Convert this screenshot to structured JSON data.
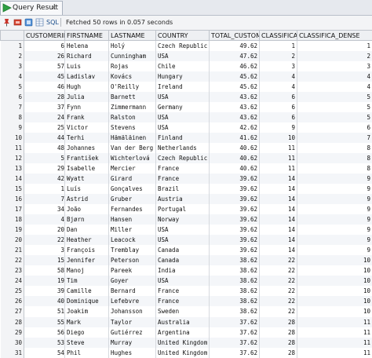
{
  "tab": {
    "title": "Query Result",
    "close_glyph": "x"
  },
  "toolbar": {
    "icons": [
      "pin-icon",
      "red-icon",
      "blue-icon",
      "grid-icon"
    ],
    "sql_label": "SQL",
    "status": "Fetched 50 rows in 0.057 seconds"
  },
  "grid": {
    "columns": [
      "CUSTOMERID",
      "FIRSTNAME",
      "LASTNAME",
      "COUNTRY",
      "TOTAL_CUSTOMER",
      "CLASSIFICA",
      "CLASSIFICA_DENSE"
    ],
    "rows": [
      [
        "1",
        "6",
        "Helena",
        "Holý",
        "Czech Republic",
        "49.62",
        "1",
        "1"
      ],
      [
        "2",
        "26",
        "Richard",
        "Cunningham",
        "USA",
        "47.62",
        "2",
        "2"
      ],
      [
        "3",
        "57",
        "Luis",
        "Rojas",
        "Chile",
        "46.62",
        "3",
        "3"
      ],
      [
        "4",
        "45",
        "Ladislav",
        "Kovács",
        "Hungary",
        "45.62",
        "4",
        "4"
      ],
      [
        "5",
        "46",
        "Hugh",
        "O'Reilly",
        "Ireland",
        "45.62",
        "4",
        "4"
      ],
      [
        "6",
        "28",
        "Julia",
        "Barnett",
        "USA",
        "43.62",
        "6",
        "5"
      ],
      [
        "7",
        "37",
        "Fynn",
        "Zimmermann",
        "Germany",
        "43.62",
        "6",
        "5"
      ],
      [
        "8",
        "24",
        "Frank",
        "Ralston",
        "USA",
        "43.62",
        "6",
        "5"
      ],
      [
        "9",
        "25",
        "Victor",
        "Stevens",
        "USA",
        "42.62",
        "9",
        "6"
      ],
      [
        "10",
        "44",
        "Terhi",
        "Hämäläinen",
        "Finland",
        "41.62",
        "10",
        "7"
      ],
      [
        "11",
        "48",
        "Johannes",
        "Van der Berg",
        "Netherlands",
        "40.62",
        "11",
        "8"
      ],
      [
        "12",
        "5",
        "František",
        "Wichterlová",
        "Czech Republic",
        "40.62",
        "11",
        "8"
      ],
      [
        "13",
        "29",
        "Isabelle",
        "Mercier",
        "France",
        "40.62",
        "11",
        "8"
      ],
      [
        "14",
        "42",
        "Wyatt",
        "Girard",
        "France",
        "39.62",
        "14",
        "9"
      ],
      [
        "15",
        "1",
        "Luís",
        "Gonçalves",
        "Brazil",
        "39.62",
        "14",
        "9"
      ],
      [
        "16",
        "7",
        "Astrid",
        "Gruber",
        "Austria",
        "39.62",
        "14",
        "9"
      ],
      [
        "17",
        "34",
        "João",
        "Fernandes",
        "Portugal",
        "39.62",
        "14",
        "9"
      ],
      [
        "18",
        "4",
        "Bjørn",
        "Hansen",
        "Norway",
        "39.62",
        "14",
        "9"
      ],
      [
        "19",
        "20",
        "Dan",
        "Miller",
        "USA",
        "39.62",
        "14",
        "9"
      ],
      [
        "20",
        "22",
        "Heather",
        "Leacock",
        "USA",
        "39.62",
        "14",
        "9"
      ],
      [
        "21",
        "3",
        "François",
        "Tremblay",
        "Canada",
        "39.62",
        "14",
        "9"
      ],
      [
        "22",
        "15",
        "Jennifer",
        "Peterson",
        "Canada",
        "38.62",
        "22",
        "10"
      ],
      [
        "23",
        "58",
        "Manoj",
        "Pareek",
        "India",
        "38.62",
        "22",
        "10"
      ],
      [
        "24",
        "19",
        "Tim",
        "Goyer",
        "USA",
        "38.62",
        "22",
        "10"
      ],
      [
        "25",
        "39",
        "Camille",
        "Bernard",
        "France",
        "38.62",
        "22",
        "10"
      ],
      [
        "26",
        "40",
        "Dominique",
        "Lefebvre",
        "France",
        "38.62",
        "22",
        "10"
      ],
      [
        "27",
        "51",
        "Joakim",
        "Johansson",
        "Sweden",
        "38.62",
        "22",
        "10"
      ],
      [
        "28",
        "55",
        "Mark",
        "Taylor",
        "Australia",
        "37.62",
        "28",
        "11"
      ],
      [
        "29",
        "56",
        "Diego",
        "Gutiérrez",
        "Argentina",
        "37.62",
        "28",
        "11"
      ],
      [
        "30",
        "53",
        "Steve",
        "Murray",
        "United Kingdom",
        "37.62",
        "28",
        "11"
      ],
      [
        "31",
        "54",
        "Phil",
        "Hughes",
        "United Kingdom",
        "37.62",
        "28",
        "11"
      ]
    ]
  }
}
